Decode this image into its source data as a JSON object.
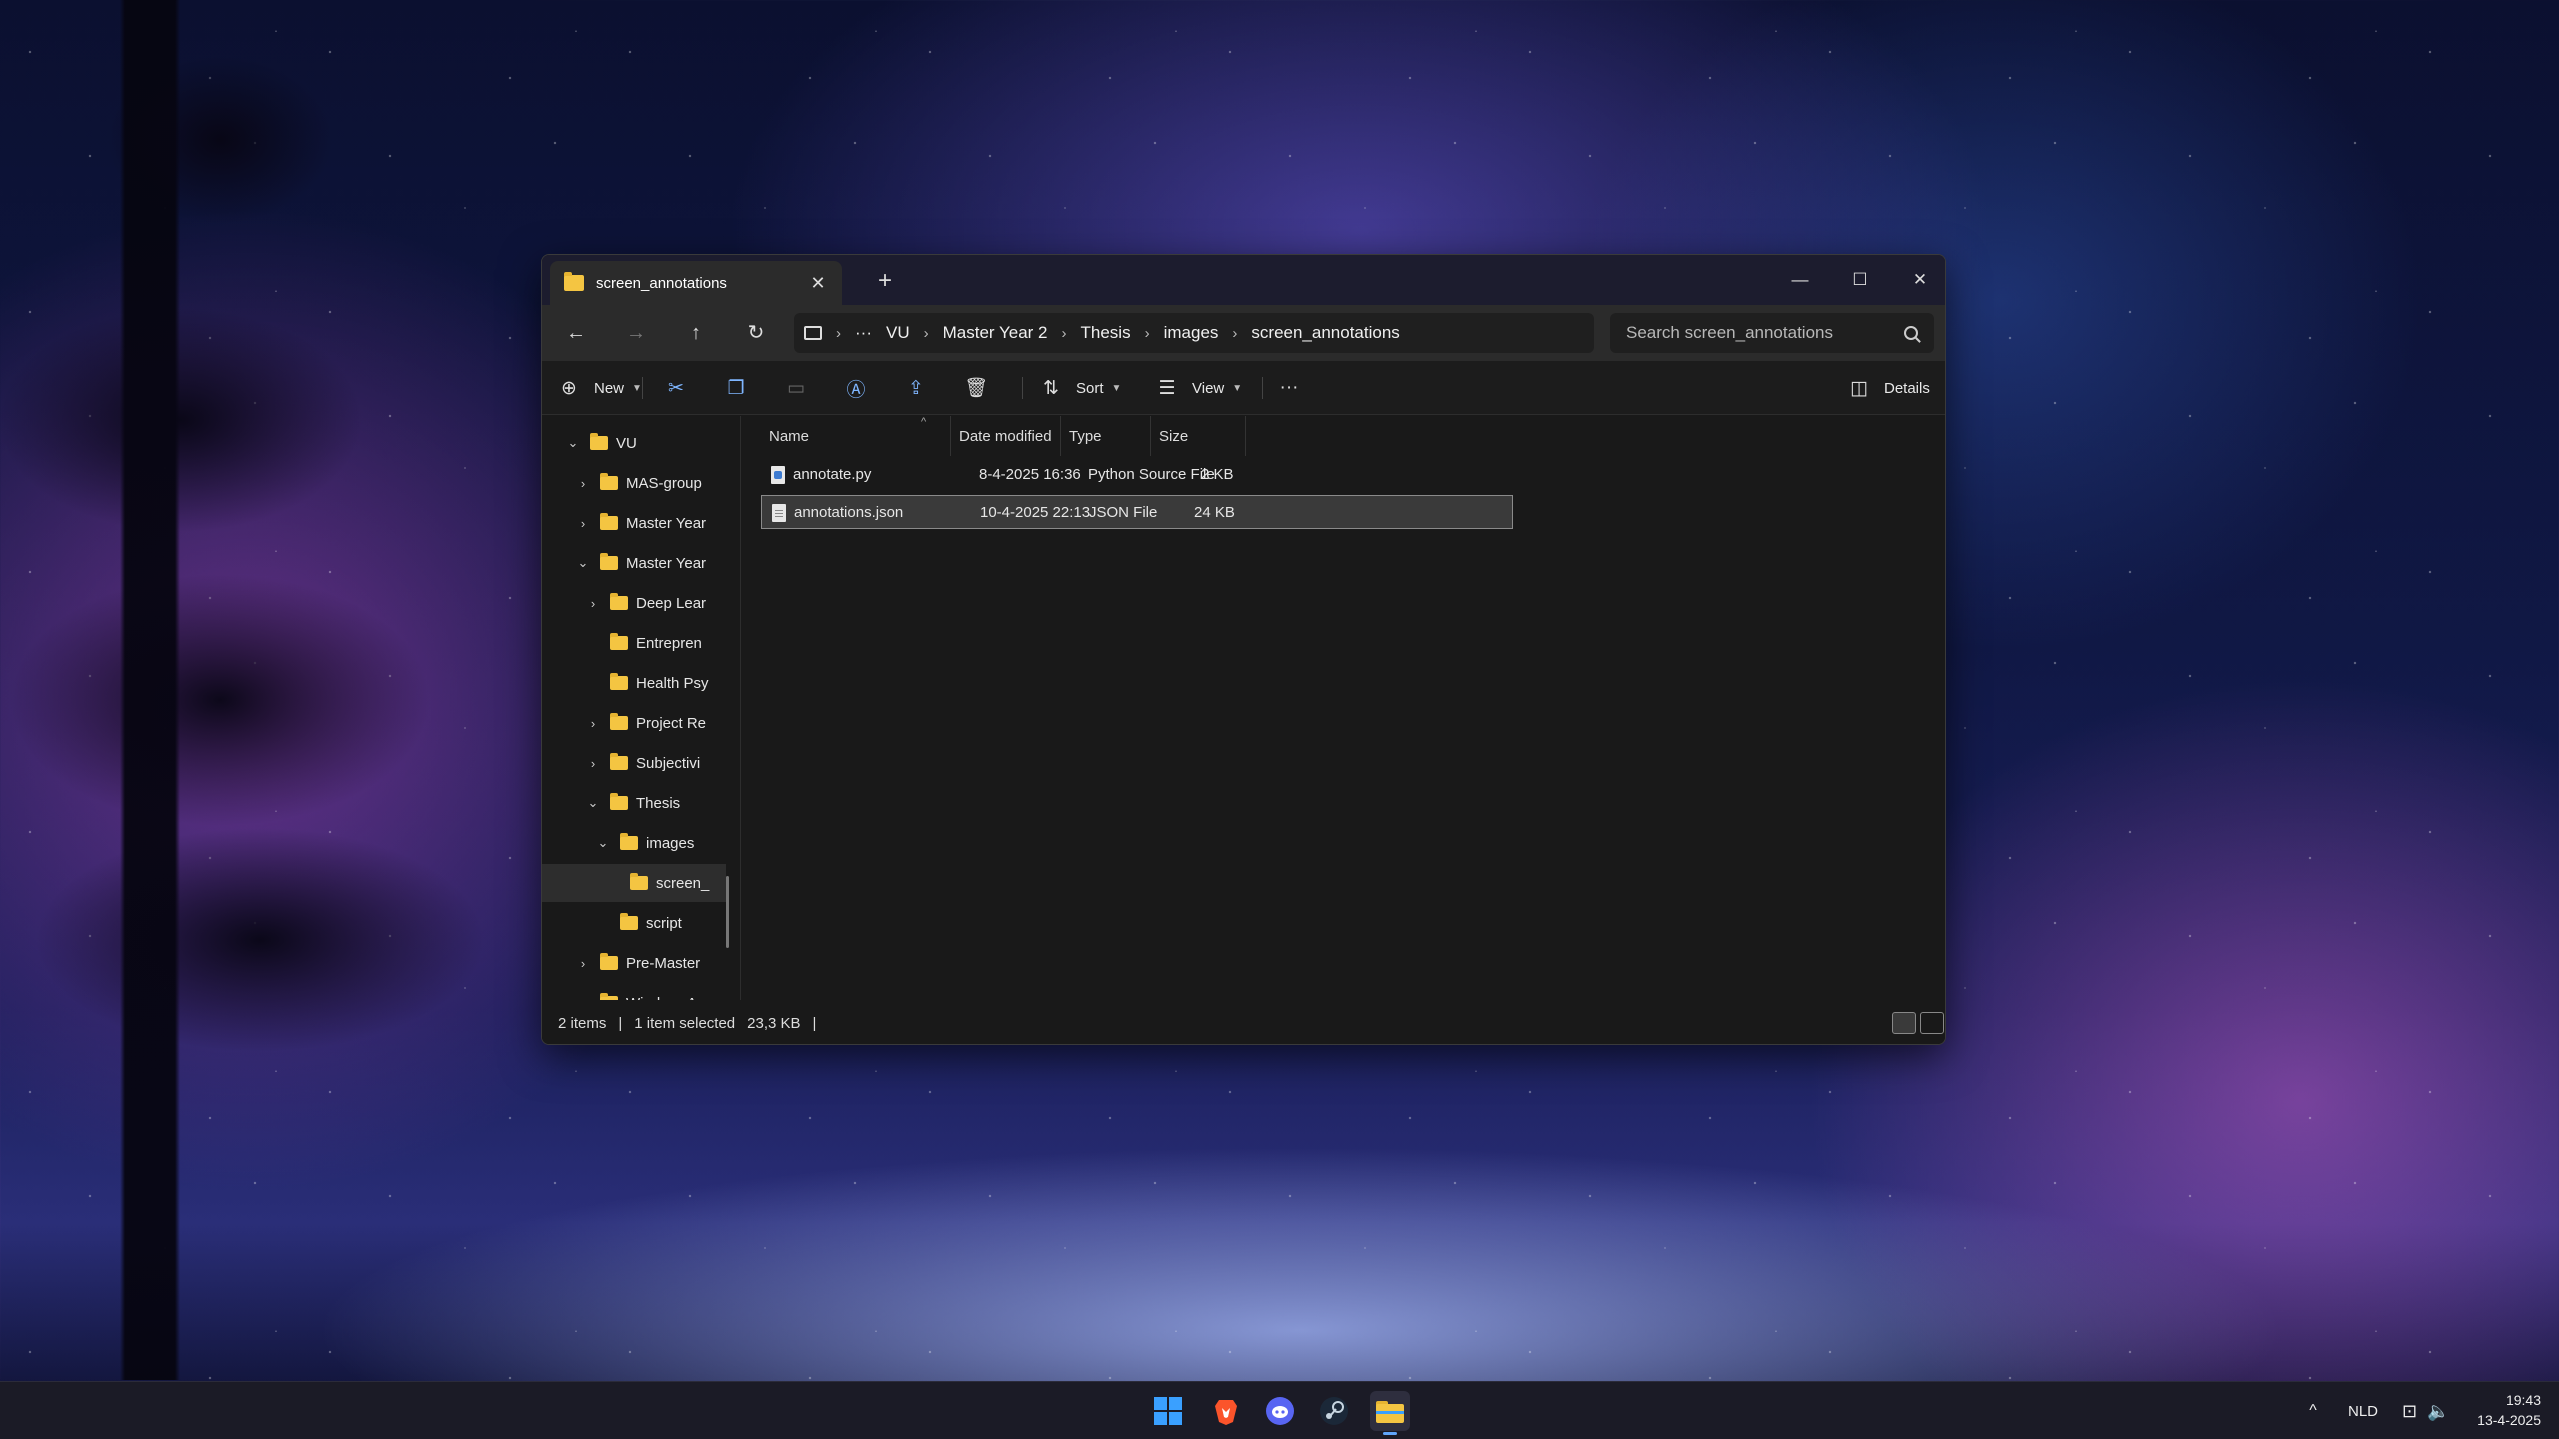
{
  "window": {
    "tab_title": "screen_annotations",
    "new_tab": "+",
    "minimize": "—",
    "maximize": "☐",
    "close": "✕"
  },
  "address": {
    "breadcrumbs": [
      "···",
      "VU",
      "Master Year 2",
      "Thesis",
      "images",
      "screen_annotations"
    ],
    "search_placeholder": "Search screen_annotations"
  },
  "toolbar": {
    "new_label": "New",
    "sort_label": "Sort",
    "view_label": "View",
    "more_label": "···",
    "details_label": "Details"
  },
  "sidebar": {
    "items": [
      {
        "label": "VU",
        "chevron": "v"
      },
      {
        "label": "MAS-group",
        "chevron": ">"
      },
      {
        "label": "Master Year",
        "chevron": ">"
      },
      {
        "label": "Master Year",
        "chevron": "v"
      },
      {
        "label": "Deep Lear",
        "chevron": ">"
      },
      {
        "label": "Entrepren",
        "chevron": ""
      },
      {
        "label": "Health Psy",
        "chevron": ""
      },
      {
        "label": "Project Re",
        "chevron": ">"
      },
      {
        "label": "Subjectivi",
        "chevron": ">"
      },
      {
        "label": "Thesis",
        "chevron": "v"
      },
      {
        "label": "images",
        "chevron": "v"
      },
      {
        "label": "screen_",
        "chevron": ""
      },
      {
        "label": "script",
        "chevron": ""
      },
      {
        "label": "Pre-Master",
        "chevron": ">"
      },
      {
        "label": "WindowsApp",
        "chevron": ""
      }
    ]
  },
  "table": {
    "columns": [
      "Name",
      "Date modified",
      "Type",
      "Size"
    ],
    "rows": [
      {
        "name": "annotate.py",
        "date": "8-4-2025 16:36",
        "type": "Python Source File",
        "size": "2 KB"
      },
      {
        "name": "annotations.json",
        "date": "10-4-2025 22:13",
        "type": "JSON File",
        "size": "24 KB"
      }
    ]
  },
  "status": {
    "items": "2 items",
    "selected": "1 item selected",
    "size": "23,3 KB"
  },
  "taskbar": {
    "language": "NLD",
    "time": "19:43",
    "date": "13-4-2025"
  },
  "colors": {
    "accent": "#60a5fa",
    "folder": "#f4c542",
    "window_bg": "#191919"
  }
}
